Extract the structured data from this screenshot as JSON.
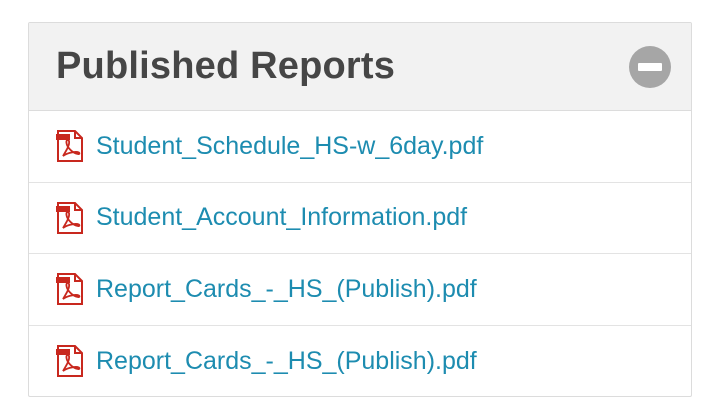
{
  "panel": {
    "title": "Published Reports",
    "collapse_icon": "minus-circle-icon",
    "reports": [
      {
        "name": "Student_Schedule_HS-w_6day.pdf",
        "icon": "pdf-file-icon"
      },
      {
        "name": "Student_Account_Information.pdf",
        "icon": "pdf-file-icon"
      },
      {
        "name": "Report_Cards_-_HS_(Publish).pdf",
        "icon": "pdf-file-icon"
      },
      {
        "name": "Report_Cards_-_HS_(Publish).pdf",
        "icon": "pdf-file-icon"
      }
    ]
  },
  "colors": {
    "link": "#1d8cb0",
    "title": "#464646",
    "header_bg": "#f2f2f2",
    "pdf_red": "#c8281e"
  }
}
